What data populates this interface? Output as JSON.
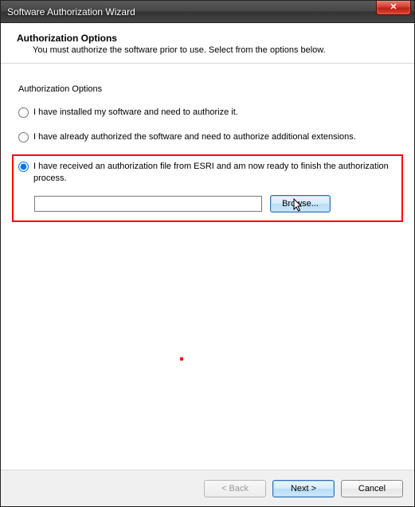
{
  "window": {
    "title": "Software Authorization Wizard",
    "close_glyph": "✕"
  },
  "header": {
    "title": "Authorization Options",
    "subtitle": "You must authorize the software prior to use. Select from the options below."
  },
  "group": {
    "label": "Authorization Options",
    "options": [
      {
        "label": "I have installed my software and need to authorize it.",
        "selected": false
      },
      {
        "label": "I have already authorized the software and need to authorize additional extensions.",
        "selected": false
      },
      {
        "label": "I have received an authorization file from ESRI and am now ready to finish the authorization process.",
        "selected": true
      }
    ],
    "file_value": "",
    "browse_label": "Browse..."
  },
  "footer": {
    "back_label": "< Back",
    "next_label": "Next >",
    "cancel_label": "Cancel"
  }
}
